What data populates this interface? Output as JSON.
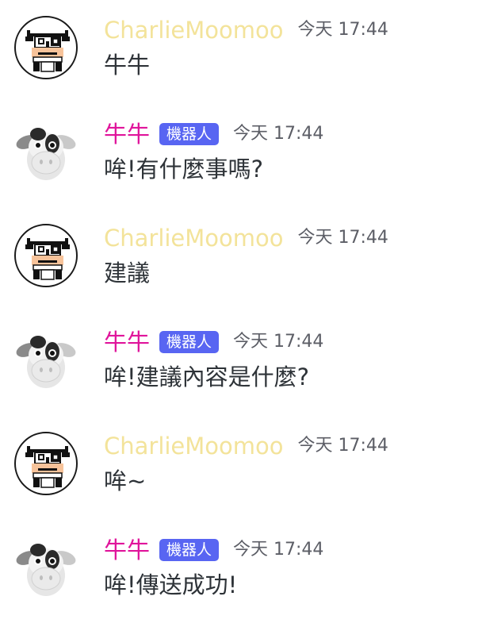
{
  "theme": {
    "user_name_color": "#f3e39a",
    "bot_name_color": "#e0149b",
    "bot_tag_color": "#5865f2",
    "timestamp_color": "#5c5e66",
    "text_color": "#2e3338"
  },
  "messages": [
    {
      "author": "CharlieMoomoo",
      "is_bot": false,
      "time": "今天 17:44",
      "text": "牛牛",
      "avatar": "pixel-cow-avatar"
    },
    {
      "author": "牛牛",
      "is_bot": true,
      "bot_tag": "機器人",
      "time": "今天 17:44",
      "text": "哞!有什麼事嗎?",
      "avatar": "plush-cow-avatar"
    },
    {
      "author": "CharlieMoomoo",
      "is_bot": false,
      "time": "今天 17:44",
      "text": "建議",
      "avatar": "pixel-cow-avatar"
    },
    {
      "author": "牛牛",
      "is_bot": true,
      "bot_tag": "機器人",
      "time": "今天 17:44",
      "text": "哞!建議內容是什麼?",
      "avatar": "plush-cow-avatar"
    },
    {
      "author": "CharlieMoomoo",
      "is_bot": false,
      "time": "今天 17:44",
      "text": "哞~",
      "avatar": "pixel-cow-avatar"
    },
    {
      "author": "牛牛",
      "is_bot": true,
      "bot_tag": "機器人",
      "time": "今天 17:44",
      "text": "哞!傳送成功!",
      "avatar": "plush-cow-avatar"
    }
  ]
}
